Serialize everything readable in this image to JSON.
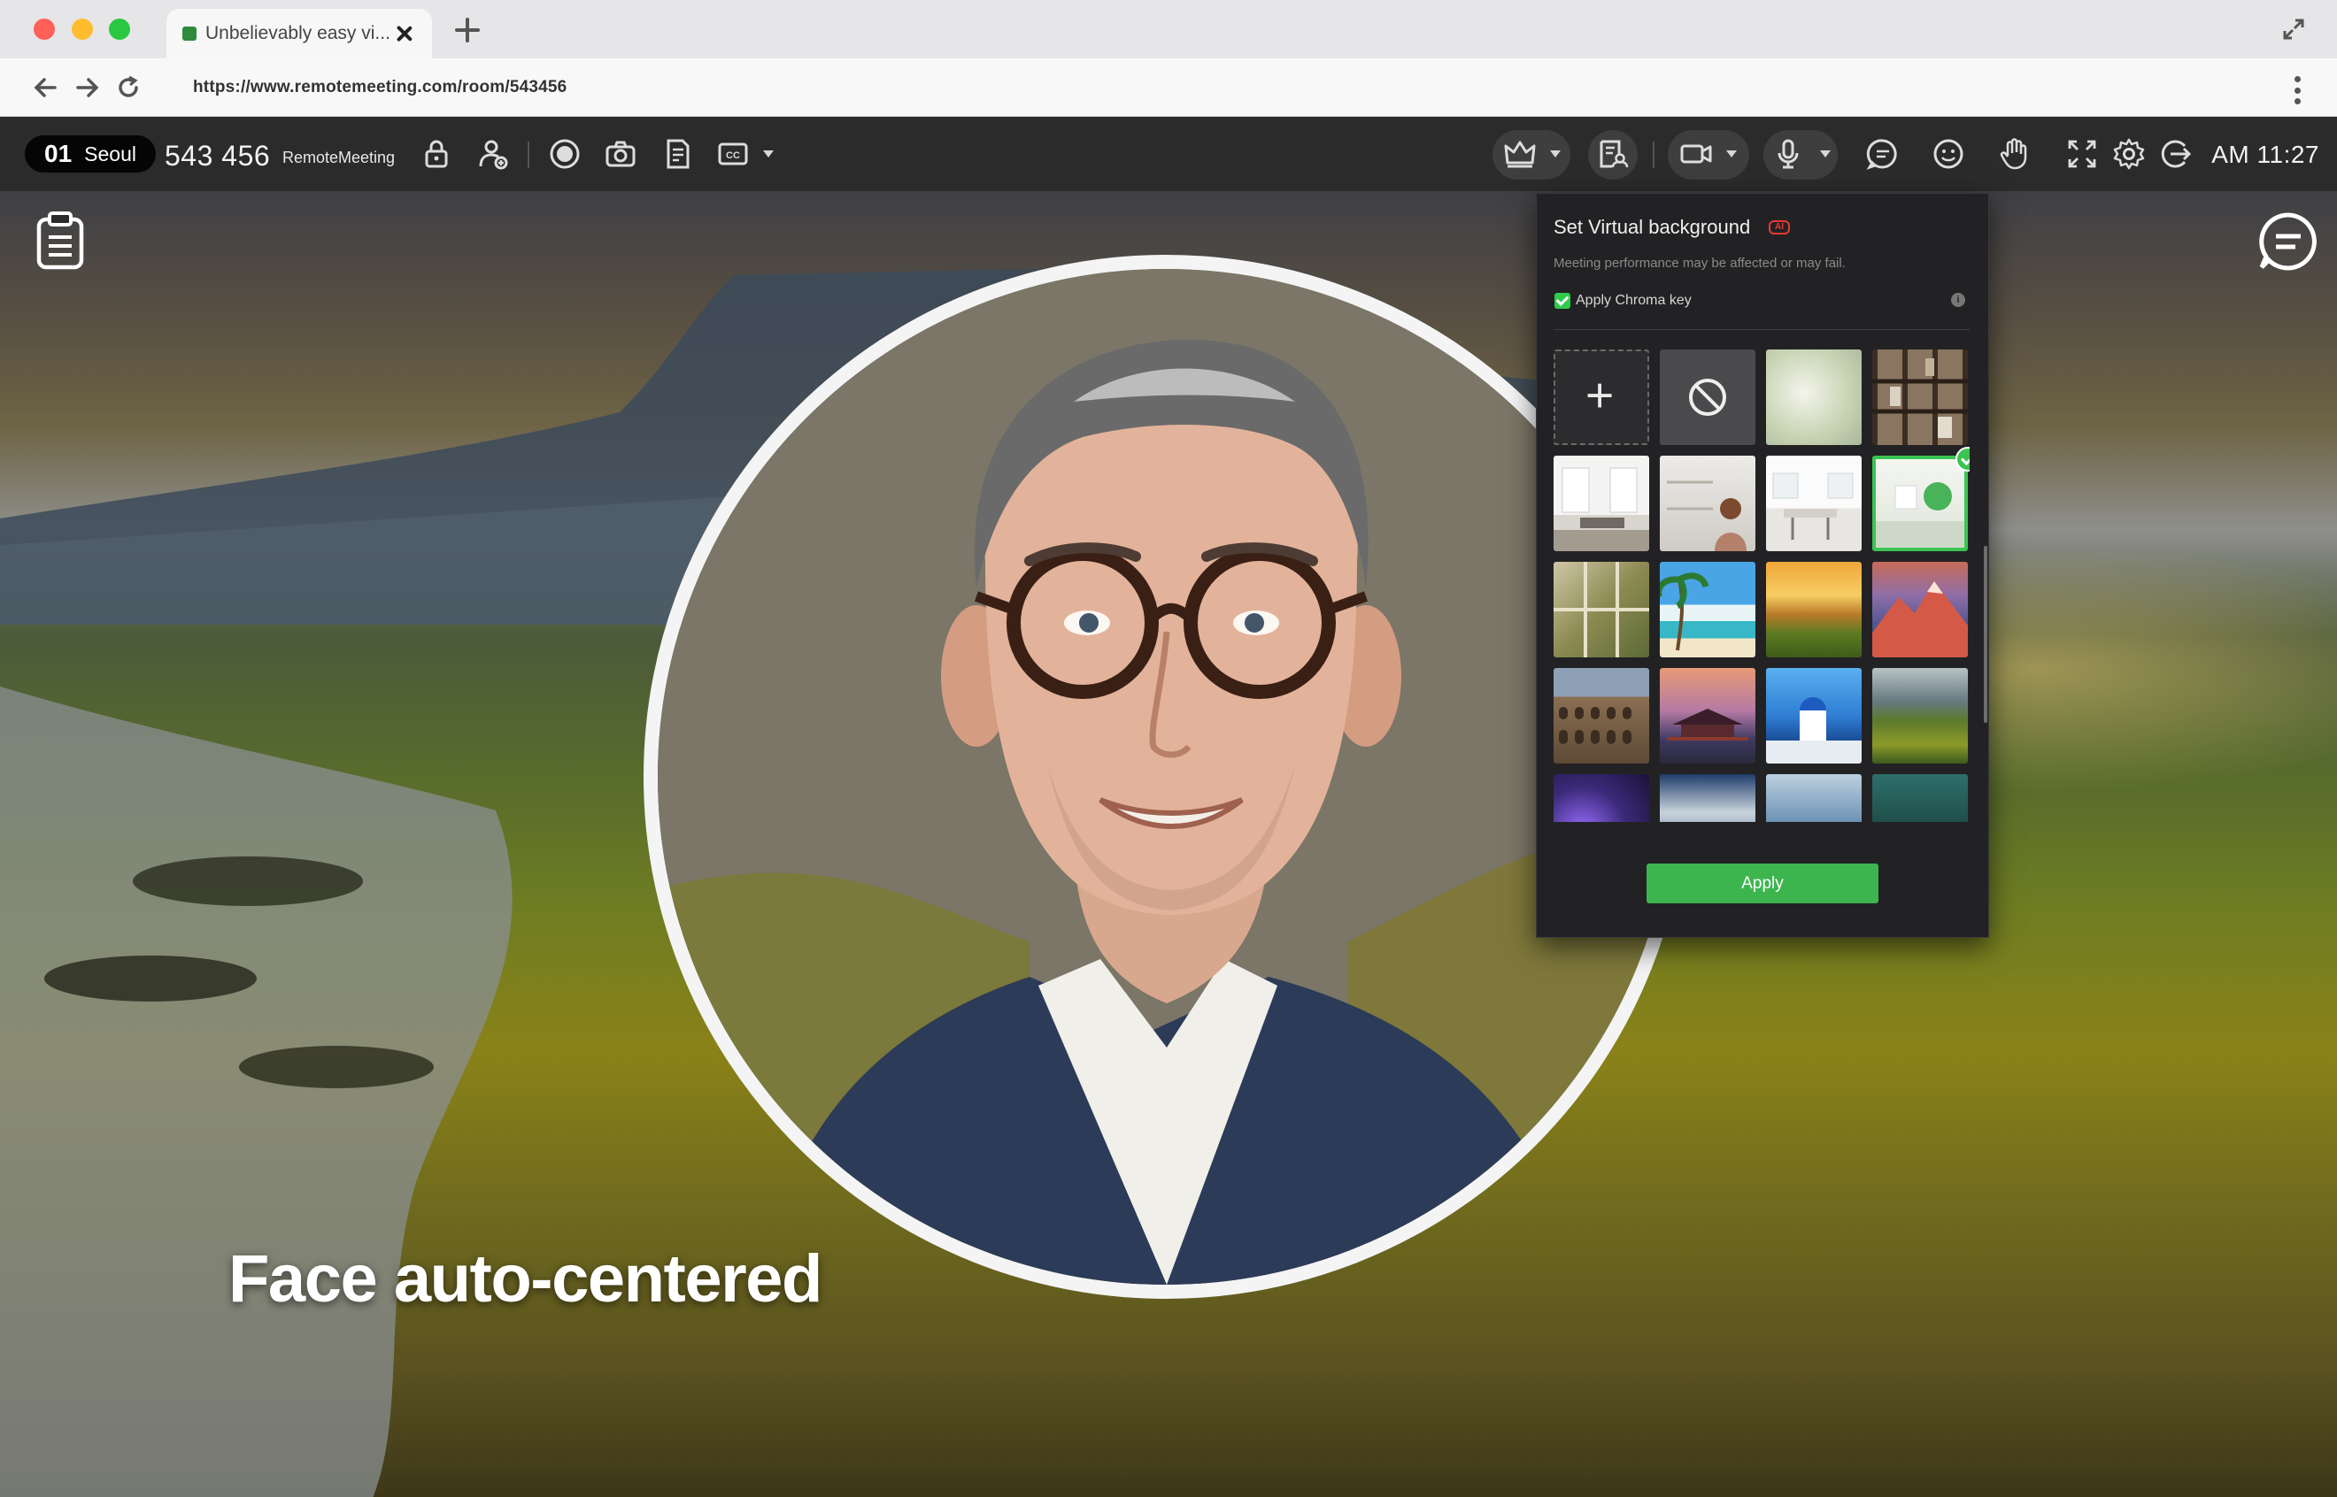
{
  "browser": {
    "tab_title": "Unbelievably easy vi...",
    "url": "https://www.remotemeeting.com/room/543456"
  },
  "toolbar": {
    "room_number": "01",
    "room_city": "Seoul",
    "room_id": "543 456",
    "brand": "RemoteMeeting",
    "clock": "AM 11:27"
  },
  "stage": {
    "caption": "Face auto-centered"
  },
  "virtual_background": {
    "title": "Set Virtual background",
    "ai_badge": "AI",
    "subtitle": "Meeting performance may be affected or may fail.",
    "chroma_key_label": "Apply Chroma key",
    "chroma_key_checked": true,
    "info_glyph": "i",
    "apply_label": "Apply",
    "accent_color": "#3db54f",
    "thumbnails": [
      {
        "name": "add-background",
        "kind": "add"
      },
      {
        "name": "no-background",
        "kind": "none"
      },
      {
        "name": "blurred-room",
        "kind": "image"
      },
      {
        "name": "bookshelf",
        "kind": "image"
      },
      {
        "name": "white-office",
        "kind": "image"
      },
      {
        "name": "shelf-with-person",
        "kind": "image"
      },
      {
        "name": "bright-kitchen",
        "kind": "image"
      },
      {
        "name": "green-minimal",
        "kind": "image",
        "selected": true
      },
      {
        "name": "window-plants",
        "kind": "image"
      },
      {
        "name": "tropical-beach",
        "kind": "image"
      },
      {
        "name": "sunset-field",
        "kind": "image"
      },
      {
        "name": "snowy-mountain",
        "kind": "image"
      },
      {
        "name": "colosseum",
        "kind": "image"
      },
      {
        "name": "palace-sunset",
        "kind": "image"
      },
      {
        "name": "blue-dome-town",
        "kind": "image"
      },
      {
        "name": "coastal-cliff",
        "kind": "image"
      },
      {
        "name": "purple-lights",
        "kind": "image"
      },
      {
        "name": "clouds",
        "kind": "image"
      },
      {
        "name": "calm-sea",
        "kind": "image"
      },
      {
        "name": "green-lake",
        "kind": "image"
      }
    ]
  }
}
